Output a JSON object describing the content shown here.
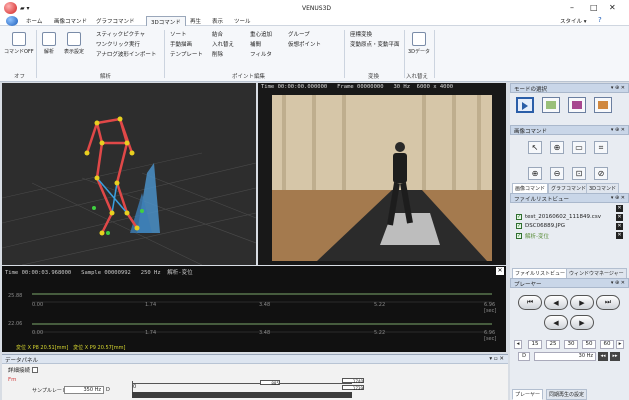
{
  "window": {
    "title": "VENUS3D",
    "minimize": "–",
    "maximize": "□",
    "close": "✕",
    "style_label": "スタイル ▾",
    "help_label": "?"
  },
  "tabs": [
    "ホーム",
    "画像コマンド",
    "グラフコマンド",
    "3Dコマンド",
    "再生",
    "表示",
    "ツール"
  ],
  "ribbon": {
    "command_off": "コマンドOFF",
    "analysis": "解析",
    "display_settings": "表示設定",
    "stick_picture": "スティックピクチャ",
    "one_click_exec": "ワンクリック実行",
    "analog_import": "アナログ波形インポート",
    "sort": "ソート",
    "manual_digitize": "手動描画",
    "template": "テンプレート",
    "join": "結合",
    "swap": "入れ替え",
    "delete": "削除",
    "center_of_mass": "重心追加",
    "interpolate": "補間",
    "filter": "フィルタ",
    "group": "グループ",
    "virtual_point": "仮想ポイント",
    "coord_transform": "座標変換",
    "change_origin": "変動原点・変動平面",
    "data_3d": "3Dデータ",
    "groups": [
      "オフ",
      "解析",
      "ポイント編集",
      "変換",
      "入れ替え"
    ]
  },
  "video": {
    "time_label": "Time",
    "time": "00:00:00.000000",
    "frame_label": "Frame",
    "frame": "00000000",
    "fps": "30 Hz",
    "resolution": "6000 x 4000"
  },
  "graph": {
    "time_label": "Time",
    "time": "00:00:03.968000",
    "sample_label": "Sample",
    "sample": "00000992",
    "rate": "250 Hz",
    "mode": "解析-変位",
    "row1": {
      "ymax": "25.88",
      "ymin": "0.00",
      "t": [
        "1.74",
        "3.48",
        "5.22",
        "6.96"
      ],
      "unit": "[sec]"
    },
    "row2": {
      "ymax": "22.06",
      "ymin": "0.00",
      "t": [
        "1.74",
        "3.48",
        "5.22",
        "6.96"
      ],
      "unit": "[sec]"
    },
    "legend1": "変位 X P8  20.51[mm]",
    "legend2": "変位 X P9  20.57[mm]"
  },
  "data_panel": {
    "title": "データパネル",
    "detail": "詳細接続",
    "fm": "Fm",
    "sample_rate_label": "サンプルレート",
    "sample_rate": "350 Hz",
    "d": "D",
    "v0": "0",
    "v1": "885",
    "v2": "1740",
    "v3": "1739"
  },
  "right": {
    "mode_select": "モードの選択",
    "image_cmd": "画像コマンド",
    "subtabs": [
      "画像コマンド",
      "グラフコマンド",
      "3Dコマンド"
    ],
    "file_list": "ファイルリストビュー",
    "files": [
      "test_20160602_111849.csv",
      "DSC06889.JPG",
      "解析-変位"
    ],
    "tabs2": [
      "ファイルリストビュー",
      "ウィンドウマネージャー"
    ],
    "player": "プレーヤー",
    "fps": [
      "15",
      "25",
      "30",
      "50",
      "60"
    ],
    "fps_value": "30 Hz",
    "d": "D",
    "bottom_tabs": [
      "プレーヤー",
      "同期再生の設定"
    ]
  }
}
